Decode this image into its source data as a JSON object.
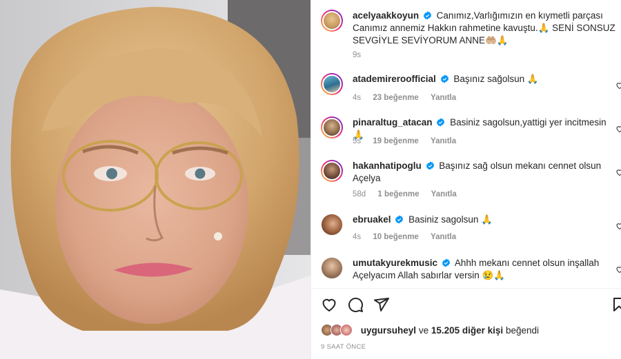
{
  "post": {
    "author": "acelyaakkoyun",
    "caption": "Canımız,Varlığımızın en kıymetli parçası Canımız annemiz Hakkın rahmetine kavuştu.🙏 SENİ SONSUZ SEVGİYLE SEVİYORUM ANNE🤲🏼🙏",
    "age": "9s"
  },
  "comments": [
    {
      "username": "atademireroofficial",
      "text": "Başınız sağolsun 🙏",
      "age": "4s",
      "likes": "23 beğenme",
      "reply": "Yanıtla"
    },
    {
      "username": "pinaraltug_atacan",
      "text": "Basiniz sagolsun,yattigi yer incitmesin🙏",
      "age": "5s",
      "likes": "19 beğenme",
      "reply": "Yanıtla"
    },
    {
      "username": "hakanhatipoglu",
      "text": "Başınız sağ olsun mekanı cennet olsun Açelya",
      "age": "58d",
      "likes": "1 beğenme",
      "reply": "Yanıtla"
    },
    {
      "username": "ebruakel",
      "text": "Basiniz sagolsun 🙏",
      "age": "4s",
      "likes": "10 beğenme",
      "reply": "Yanıtla"
    },
    {
      "username": "umutakyurekmusic",
      "text": "Ahhh mekanı cennet olsun inşallah Açelyacım Allah sabırlar versin 😢🙏",
      "age": "",
      "likes": "",
      "reply": ""
    }
  ],
  "likes_line": {
    "user": "uygursuheyl",
    "connector": "ve",
    "others": "15.205 diğer kişi",
    "suffix": "beğendi"
  },
  "timestamp": "9 SAAT ÖNCE",
  "icons": {
    "like": "heart-icon",
    "comment": "comment-icon",
    "share": "share-icon",
    "save": "bookmark-icon",
    "verified": "verified-badge-icon"
  },
  "colors": {
    "verified": "#0095f6",
    "muted": "#8e8e8e",
    "text": "#262626"
  }
}
